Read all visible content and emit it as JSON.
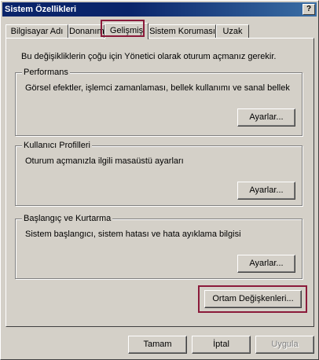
{
  "window": {
    "title": "Sistem Özellikleri",
    "help_label": "?"
  },
  "tabs": [
    {
      "label": "Bilgisayar Adı"
    },
    {
      "label": "Donanım"
    },
    {
      "label": "Gelişmiş"
    },
    {
      "label": "Sistem Koruması"
    },
    {
      "label": "Uzak"
    }
  ],
  "active_tab": "Gelişmiş",
  "intro_text": "Bu değişikliklerin çoğu için Yönetici olarak oturum açmanız gerekir.",
  "groups": {
    "performance": {
      "title": "Performans",
      "description": "Görsel efektler, işlemci zamanlaması, bellek kullanımı ve sanal bellek",
      "button_label": "Ayarlar..."
    },
    "user_profiles": {
      "title": "Kullanıcı Profilleri",
      "description": "Oturum açmanızla ilgili masaüstü ayarları",
      "button_label": "Ayarlar..."
    },
    "startup_recovery": {
      "title": "Başlangıç ve Kurtarma",
      "description": "Sistem başlangıcı, sistem hatası ve hata ayıklama bilgisi",
      "button_label": "Ayarlar..."
    }
  },
  "env_button_label": "Ortam Değişkenleri...",
  "footer": {
    "ok_label": "Tamam",
    "cancel_label": "İptal",
    "apply_label": "Uygula"
  },
  "colors": {
    "titlebar": "#0a246a",
    "face": "#d4d0c8",
    "highlight": "#8b1a3a"
  }
}
